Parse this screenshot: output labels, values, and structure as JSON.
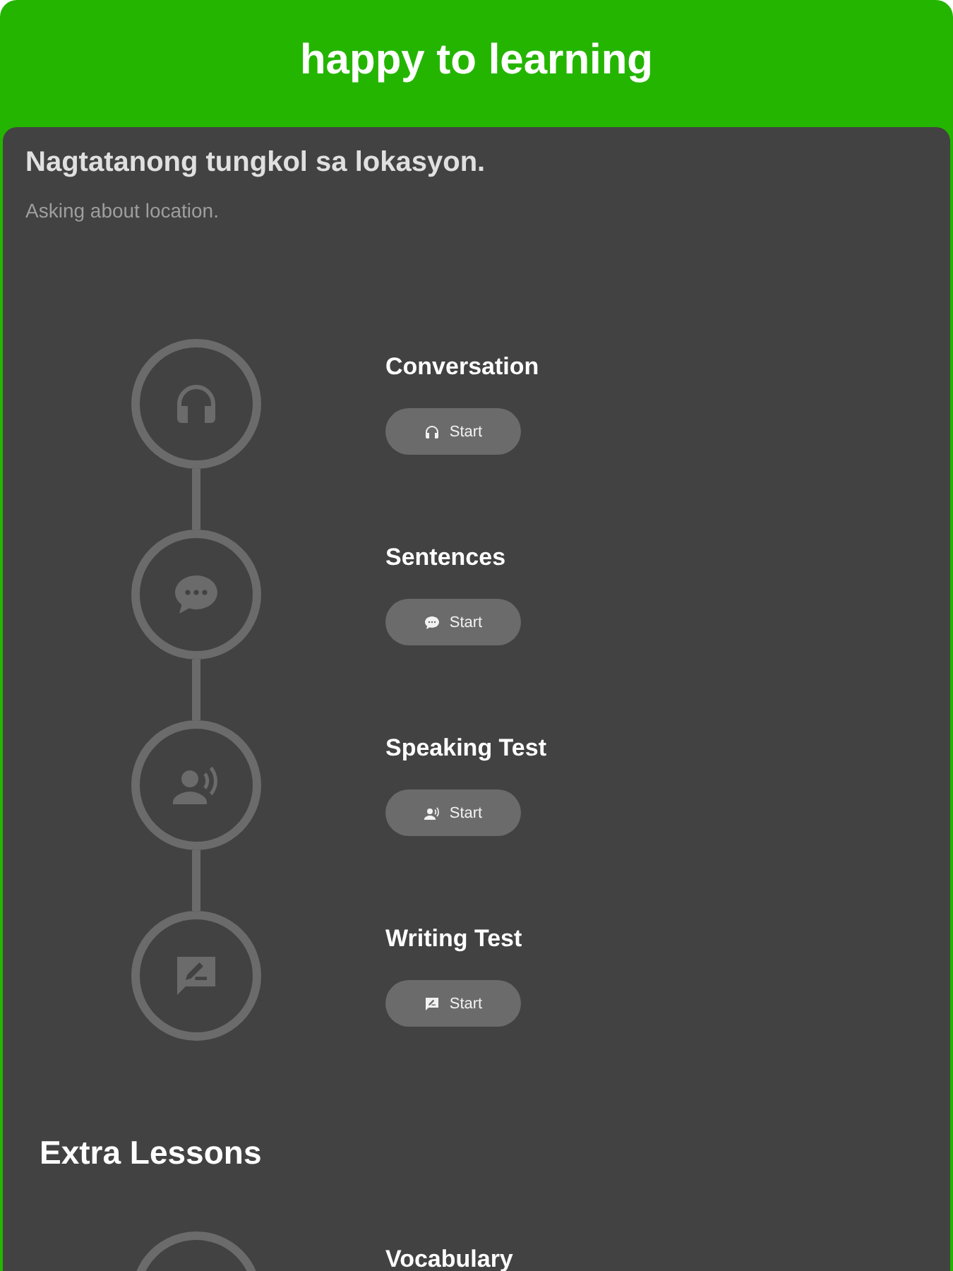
{
  "header": {
    "title": "happy to learning"
  },
  "lesson": {
    "title": "Nagtatanong tungkol sa lokasyon.",
    "subtitle": "Asking about location."
  },
  "steps": [
    {
      "title": "Conversation",
      "kind": "headphones",
      "button": "Start"
    },
    {
      "title": "Sentences",
      "kind": "chat",
      "button": "Start"
    },
    {
      "title": "Speaking Test",
      "kind": "speaker",
      "button": "Start"
    },
    {
      "title": "Writing Test",
      "kind": "write",
      "button": "Start"
    }
  ],
  "extra": {
    "heading": "Extra Lessons",
    "steps": [
      {
        "title": "Vocabulary"
      }
    ]
  }
}
